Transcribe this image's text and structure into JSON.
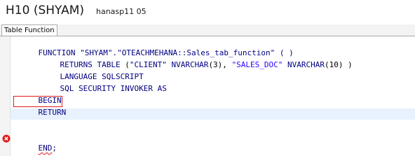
{
  "header": {
    "title": "H10 (SHYAM)",
    "subtitle": "hanasp11 05"
  },
  "tab": {
    "label": "Table Function"
  },
  "code": {
    "line1": {
      "kw": "FUNCTION ",
      "name": "\"SHYAM\".\"OTEACHMEHANA::Sales_tab_function\"",
      "tail": " ( )"
    },
    "line2": {
      "kw": "RETURNS TABLE ",
      "a": "(",
      "c1": "\"CLIENT\"",
      "t1": " NVARCHAR",
      "a1": "(3), ",
      "c2": "\"SALES_DOC\"",
      "t2": " NVARCHAR",
      "a2": "(10) )"
    },
    "line3": {
      "kw": "LANGUAGE SQLSCRIPT"
    },
    "line4": {
      "kw": "SQL SECURITY INVOKER AS"
    },
    "line5": {
      "kw": "BEGIN"
    },
    "line6": {
      "kw": "RETURN"
    },
    "line7": {
      "kw": "END",
      "tail": ";"
    }
  },
  "colors": {
    "keyword": "#000080",
    "string": "#2a00ff",
    "error": "#e01b1b",
    "current_line": "#e8f2fe"
  },
  "icons": {
    "error_marker": "error-icon"
  }
}
